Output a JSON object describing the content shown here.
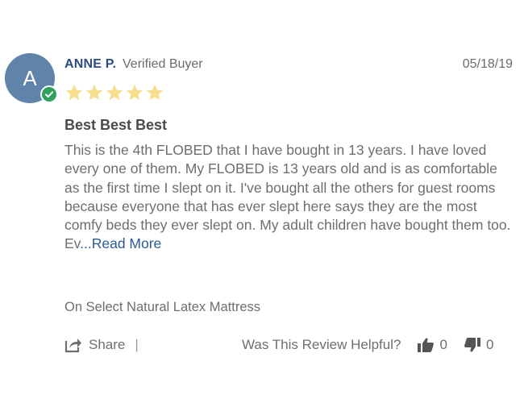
{
  "reviewer": {
    "initial": "A",
    "name": "ANNE P.",
    "badge": "Verified Buyer",
    "date": "05/18/19"
  },
  "rating": {
    "stars": 5,
    "max": 5,
    "star_color": "#f5df8e"
  },
  "review": {
    "title": "Best Best Best",
    "body": "This is the 4th FLOBED that I have bought in 13 years. I have loved every one of them. My FLOBED is 13 years old and is as comfortable as the first time I slept on it. I've bought all the others for guest rooms because everyone that has ever slept here says they are the most comfy beds they ever slept on. My adult children have bought them too. Ev",
    "read_more": "...Read More",
    "product": "On Select Natural Latex Mattress"
  },
  "actions": {
    "share_label": "Share",
    "divider": "|",
    "helpful_label": "Was This Review Helpful?",
    "thumbs_up_count": "0",
    "thumbs_down_count": "0"
  },
  "colors": {
    "avatar": "#5f83a9",
    "verified": "#2fa15a",
    "name": "#2b4c7e",
    "link": "#2b5a93"
  },
  "icons": {
    "share": "share-icon",
    "thumbs_up": "thumbs-up-icon",
    "thumbs_down": "thumbs-down-icon",
    "verified": "check-icon",
    "star": "star-icon"
  }
}
